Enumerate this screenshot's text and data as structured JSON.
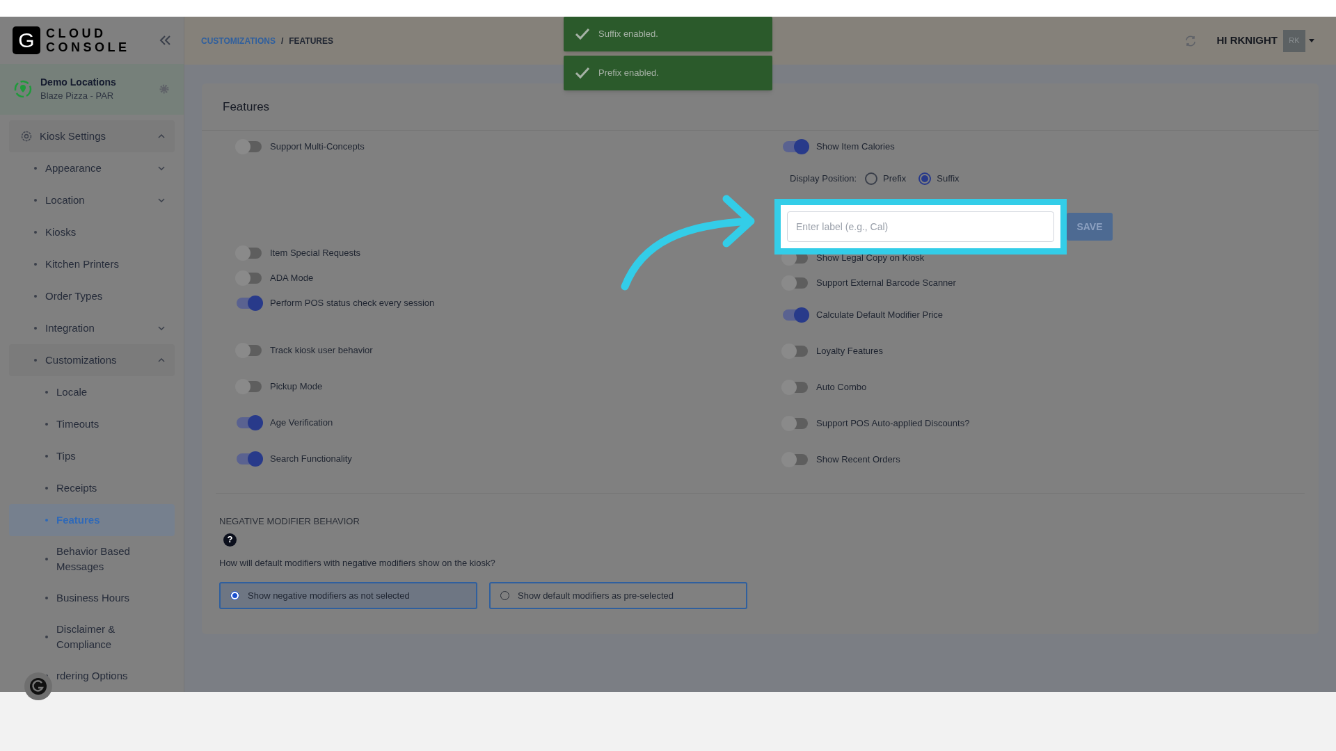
{
  "sidebar": {
    "logo": {
      "mark": "G",
      "line1": "CLOUD",
      "line2": "CONSOLE"
    },
    "location": {
      "name": "Demo Locations",
      "subtitle": "Blaze Pizza - PAR"
    },
    "items": [
      {
        "label": "Kiosk Settings",
        "kind": "group",
        "expanded": true,
        "selected": false,
        "children": [
          {
            "label": "Appearance",
            "kind": "group",
            "expanded": false,
            "selected": false
          },
          {
            "label": "Location",
            "kind": "group",
            "expanded": false,
            "selected": false
          },
          {
            "label": "Kiosks",
            "kind": "link",
            "selected": false
          },
          {
            "label": "Kitchen Printers",
            "kind": "link",
            "selected": false
          },
          {
            "label": "Order Types",
            "kind": "link",
            "selected": false
          },
          {
            "label": "Integration",
            "kind": "group",
            "expanded": false,
            "selected": false
          },
          {
            "label": "Customizations",
            "kind": "group",
            "expanded": true,
            "selected": false,
            "children": [
              {
                "label": "Locale",
                "kind": "link",
                "selected": false
              },
              {
                "label": "Timeouts",
                "kind": "link",
                "selected": false
              },
              {
                "label": "Tips",
                "kind": "link",
                "selected": false
              },
              {
                "label": "Receipts",
                "kind": "link",
                "selected": false
              },
              {
                "label": "Features",
                "kind": "link",
                "selected": true
              },
              {
                "label": "Behavior Based Messages",
                "kind": "link",
                "selected": false
              },
              {
                "label": "Business Hours",
                "kind": "link",
                "selected": false
              },
              {
                "label": "Disclaimer & Compliance",
                "kind": "link",
                "selected": false
              },
              {
                "label": "rdering Options",
                "kind": "link",
                "selected": false
              }
            ]
          }
        ]
      }
    ]
  },
  "header": {
    "breadcrumb": [
      "CUSTOMIZATIONS",
      "FEATURES"
    ],
    "separator": "/",
    "user": "HI RKNIGHT",
    "avatar": "RK"
  },
  "toasts": [
    "Suffix enabled.",
    "Prefix enabled."
  ],
  "features": {
    "title": "Features",
    "left": [
      {
        "kind": "toggle",
        "label": "Support Multi-Concepts",
        "on": false
      },
      {
        "kind": "toggle",
        "label": "Item Special Requests",
        "on": false
      },
      {
        "kind": "toggle",
        "label": "ADA Mode",
        "on": false
      },
      {
        "kind": "toggle",
        "label": "Perform POS status check every session",
        "on": true
      },
      {
        "kind": "toggle",
        "label": "Track kiosk user behavior",
        "on": false
      },
      {
        "kind": "toggle",
        "label": "Pickup Mode",
        "on": false
      },
      {
        "kind": "toggle",
        "label": "Age Verification",
        "on": true
      },
      {
        "kind": "toggle",
        "label": "Search Functionality",
        "on": true
      }
    ],
    "right": [
      {
        "kind": "toggle",
        "label": "Show Item Calories",
        "on": true
      },
      {
        "kind": "radio_group",
        "label": "Display Position:",
        "options": [
          {
            "label": "Prefix",
            "selected": false
          },
          {
            "label": "Suffix",
            "selected": true
          }
        ]
      },
      {
        "kind": "text_input",
        "placeholder": "Enter label (e.g., Cal)",
        "button": "SAVE",
        "highlighted": true
      },
      {
        "kind": "toggle",
        "label": "Show Legal Copy on Kiosk",
        "on": false
      },
      {
        "kind": "toggle",
        "label": "Support External Barcode Scanner",
        "on": false
      },
      {
        "kind": "toggle",
        "label": "Calculate Default Modifier Price",
        "on": true
      },
      {
        "kind": "toggle",
        "label": "Loyalty Features",
        "on": false
      },
      {
        "kind": "toggle",
        "label": "Auto Combo",
        "on": false
      },
      {
        "kind": "toggle",
        "label": "Support POS Auto-applied Discounts?",
        "on": false
      },
      {
        "kind": "toggle",
        "label": "Show Recent Orders",
        "on": false
      }
    ]
  },
  "negative_modifier": {
    "heading": "NEGATIVE MODIFIER BEHAVIOR",
    "help": "?",
    "question": "How will default modifiers with negative modifiers show on the kiosk?",
    "options": [
      {
        "label": "Show negative modifiers as not selected",
        "selected": true
      },
      {
        "label": "Show default modifiers as pre-selected",
        "selected": false
      }
    ]
  }
}
